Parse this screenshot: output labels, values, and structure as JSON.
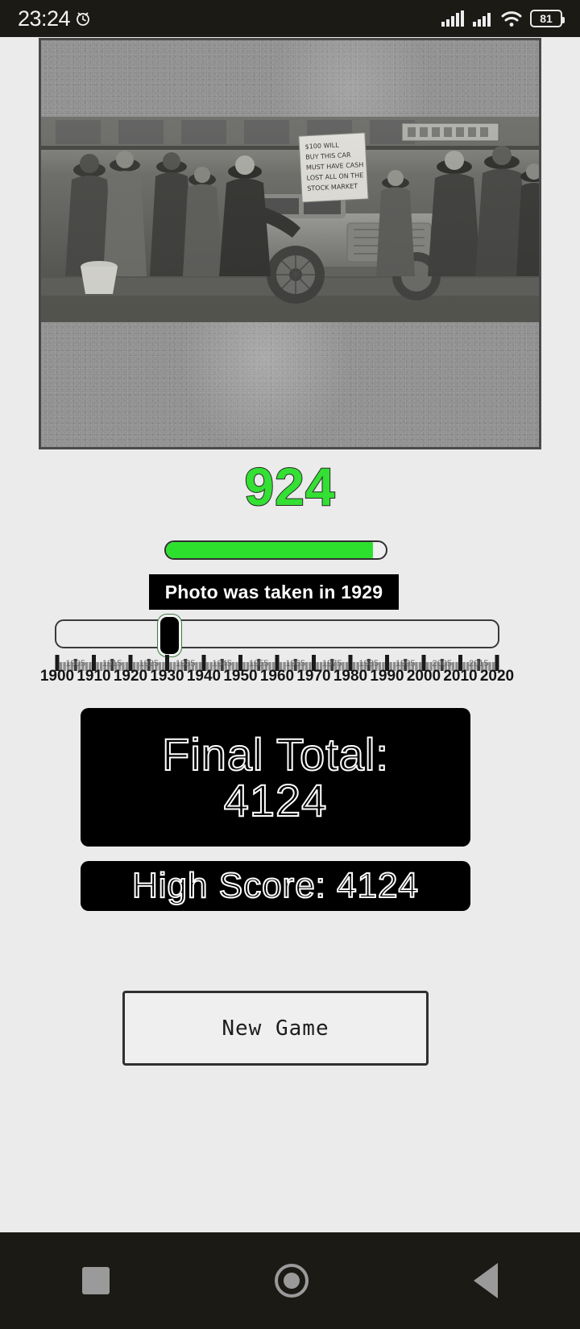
{
  "statusbar": {
    "time": "23:24",
    "alarm_icon": "alarm-clock-icon",
    "signal_icon_1": "cellular-signal-icon",
    "signal_icon_2": "cellular-signal-icon",
    "wifi_icon": "wifi-icon",
    "battery_level": "81"
  },
  "photo": {
    "caption_sign_lines": [
      "$100 WILL",
      "BUY THIS CAR",
      "MUST HAVE CASH",
      "LOST ALL ON THE",
      "STOCK MARKET"
    ],
    "description": "Historic black-and-white photo of a crowd around a car with a for-sale sign during the 1929 stock market crash"
  },
  "round": {
    "score": "924",
    "score_color": "#33e033",
    "progress_percent": 94,
    "answer_banner": "Photo was taken in 1929"
  },
  "slider": {
    "value": "1929",
    "min": "1900",
    "max": "2020",
    "major_ticks": [
      "1900",
      "1910",
      "1920",
      "1930",
      "1940",
      "1950",
      "1960",
      "1970",
      "1980",
      "1990",
      "2000",
      "2010",
      "2020"
    ],
    "minor_ticks": [
      "1905",
      "1915",
      "1925",
      "1935",
      "1945",
      "1955",
      "1965",
      "1975",
      "1985",
      "1995",
      "2005",
      "2015"
    ]
  },
  "results": {
    "final_total_label": "Final Total:",
    "final_total_value": "4124",
    "high_score": "High Score: 4124"
  },
  "actions": {
    "new_game": "New  Game"
  },
  "navbar": {
    "recents_icon": "square-recents-icon",
    "home_icon": "circle-home-icon",
    "back_icon": "triangle-back-icon"
  }
}
